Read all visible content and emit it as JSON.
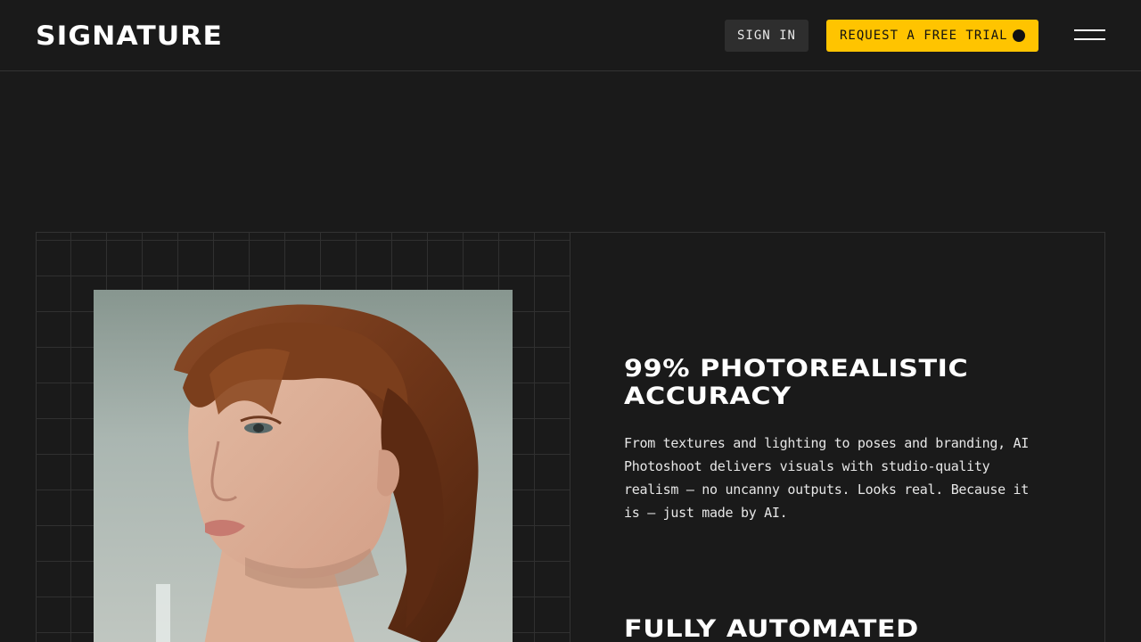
{
  "header": {
    "logo": "SIGNATURE",
    "sign_in_label": "SIGN IN",
    "trial_label": "REQUEST A FREE TRIAL",
    "menu_icon": "hamburger-menu-icon"
  },
  "features": [
    {
      "title": "99% PHOTOREALISTIC ACCURACY",
      "body": "From textures and lighting to poses and branding, AI Photoshoot delivers visuals with studio-quality realism — no uncanny outputs. Looks real. Because it is — just made by AI."
    },
    {
      "title": "FULLY AUTOMATED",
      "body": ""
    }
  ],
  "colors": {
    "background": "#1a1a1a",
    "accent": "#ffc400",
    "button_dark": "#2e2e2e",
    "border": "#333333"
  }
}
